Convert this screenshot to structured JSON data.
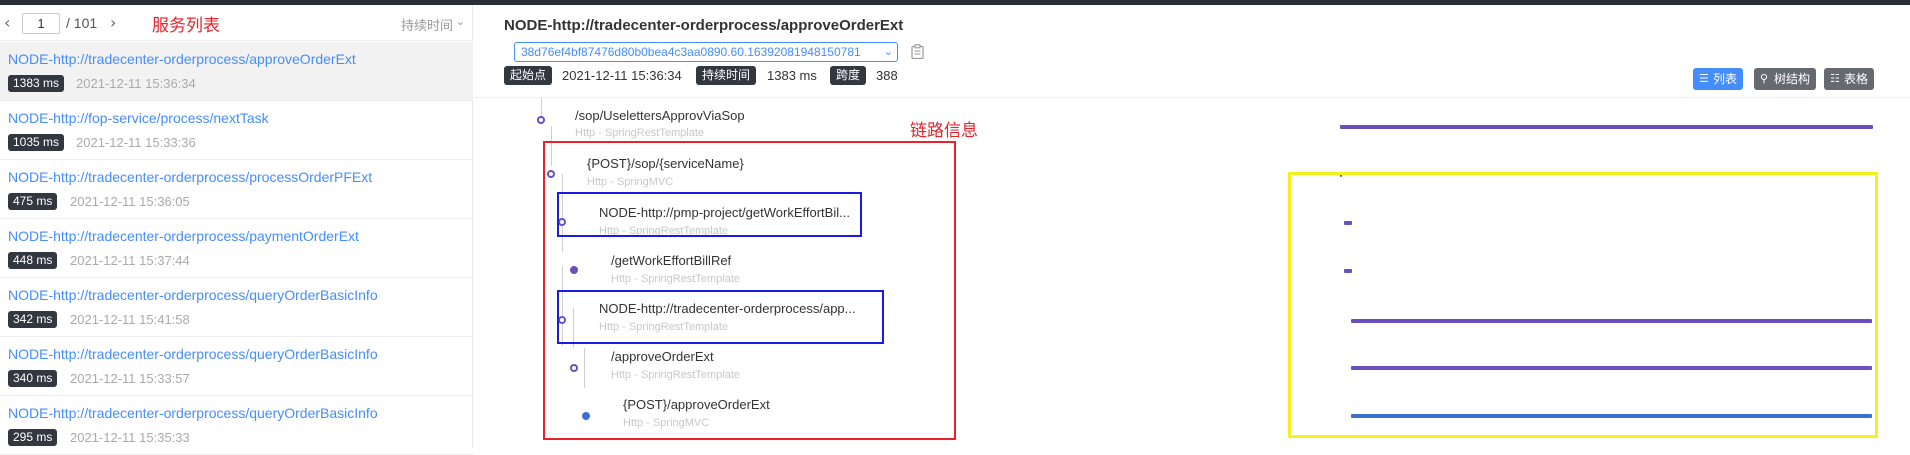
{
  "pager": {
    "prev_icon": "chevron-left-icon",
    "page": "1",
    "total": "/ 101",
    "next_icon": "chevron-right-icon",
    "annotation": "服务列表",
    "sort_label": "持续时间",
    "sort_icon": "chevron-down-icon"
  },
  "traces": [
    {
      "endpoint": "NODE-http://tradecenter-orderprocess/approveOrderExt",
      "duration": "1383 ms",
      "time": "2021-12-11 15:36:34"
    },
    {
      "endpoint": "NODE-http://fop-service/process/nextTask",
      "duration": "1035 ms",
      "time": "2021-12-11 15:33:36"
    },
    {
      "endpoint": "NODE-http://tradecenter-orderprocess/processOrderPFExt",
      "duration": "475 ms",
      "time": "2021-12-11 15:36:05"
    },
    {
      "endpoint": "NODE-http://tradecenter-orderprocess/paymentOrderExt",
      "duration": "448 ms",
      "time": "2021-12-11 15:37:44"
    },
    {
      "endpoint": "NODE-http://tradecenter-orderprocess/queryOrderBasicInfo",
      "duration": "342 ms",
      "time": "2021-12-11 15:41:58"
    },
    {
      "endpoint": "NODE-http://tradecenter-orderprocess/queryOrderBasicInfo",
      "duration": "340 ms",
      "time": "2021-12-11 15:33:57"
    },
    {
      "endpoint": "NODE-http://tradecenter-orderprocess/queryOrderBasicInfo",
      "duration": "295 ms",
      "time": "2021-12-11 15:35:33"
    }
  ],
  "detail": {
    "title": "NODE-http://tradecenter-orderprocess/approveOrderExt",
    "trace_id": "38d76ef4bf87476d80b0bea4c3aa0890.60.16392081948150781",
    "copy_icon": "copy-icon",
    "start_label": "起始点",
    "start_value": "2021-12-11 15:36:34",
    "duration_label": "持续时间",
    "duration_value": "1383 ms",
    "span_label": "跨度",
    "span_value": "388",
    "views": [
      {
        "label": "列表",
        "icon": "list-icon"
      },
      {
        "label": "树结构",
        "icon": "tree-icon"
      },
      {
        "label": "表格",
        "icon": "table-icon"
      }
    ]
  },
  "annotation_link": "链路信息",
  "spans": [
    {
      "name": "/sop/UselettersApprovViaSop",
      "sub": "Http - SpringRestTemplate"
    },
    {
      "name": "{POST}/sop/{serviceName}",
      "sub": "Http - SpringMVC"
    },
    {
      "name": "NODE-http://pmp-project/getWorkEffortBil...",
      "sub": "Http - SpringRestTemplate"
    },
    {
      "name": "/getWorkEffortBillRef",
      "sub": "Http - SpringRestTemplate"
    },
    {
      "name": "NODE-http://tradecenter-orderprocess/app...",
      "sub": "Http - SpringRestTemplate"
    },
    {
      "name": "/approveOrderExt",
      "sub": "Http - SpringRestTemplate"
    },
    {
      "name": "{POST}/approveOrderExt",
      "sub": "Http - SpringMVC"
    }
  ],
  "colors": {
    "accent": "#448dfe",
    "bar": "#6a4fbf",
    "bar_blue": "#3b6fd6",
    "annotation_red": "#e8212b",
    "annotation_blue": "#1a1ae0",
    "annotation_yellow": "#f5f01c"
  }
}
